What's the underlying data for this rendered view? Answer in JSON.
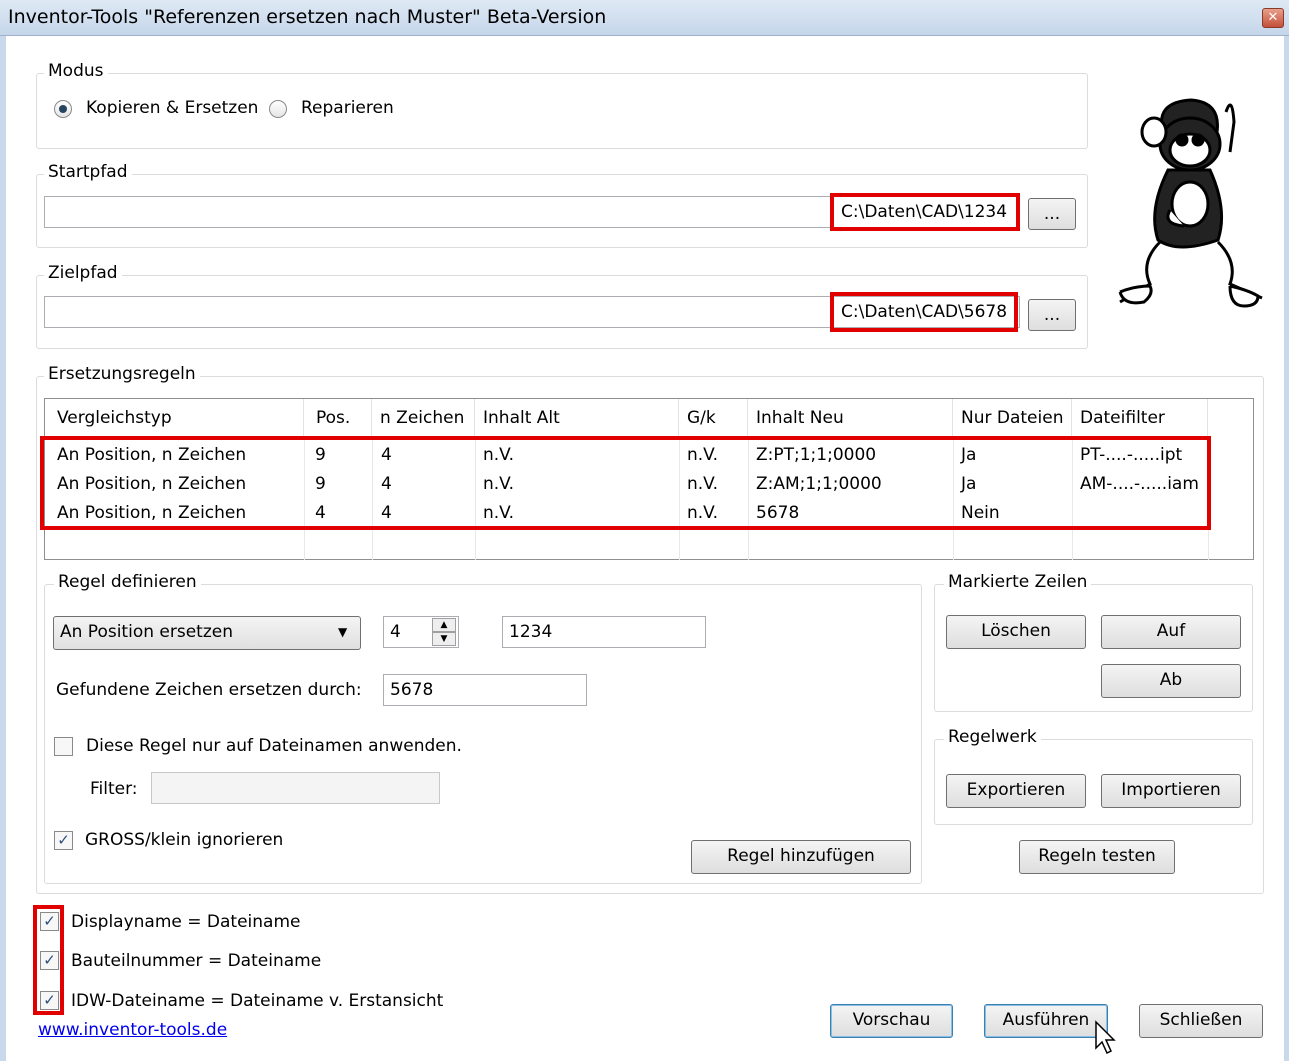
{
  "window": {
    "title": "Inventor-Tools \"Referenzen ersetzen nach Muster\" Beta-Version",
    "close_glyph": "✕"
  },
  "modus": {
    "legend": "Modus",
    "options": [
      {
        "label": "Kopieren & Ersetzen",
        "checked": true
      },
      {
        "label": "Reparieren",
        "checked": false
      }
    ]
  },
  "startpfad": {
    "legend": "Startpfad",
    "value": "C:\\Daten\\CAD\\1234",
    "browse_label": "..."
  },
  "zielpfad": {
    "legend": "Zielpfad",
    "value": "C:\\Daten\\CAD\\5678",
    "browse_label": "..."
  },
  "ersetzungsregeln": {
    "legend": "Ersetzungsregeln",
    "columns": [
      "Vergleichstyp",
      "Pos.",
      "n Zeichen",
      "Inhalt Alt",
      "G/k",
      "Inhalt Neu",
      "Nur Dateien",
      "Dateifilter"
    ],
    "rows": [
      [
        "An Position, n Zeichen",
        "9",
        "4",
        "n.V.",
        "n.V.",
        "Z:PT;1;1;0000",
        "Ja",
        "PT-....-.....ipt"
      ],
      [
        "An Position, n Zeichen",
        "9",
        "4",
        "n.V.",
        "n.V.",
        "Z:AM;1;1;0000",
        "Ja",
        "AM-....-.....iam"
      ],
      [
        "An Position, n Zeichen",
        "4",
        "4",
        "n.V.",
        "n.V.",
        "5678",
        "Nein",
        ""
      ]
    ]
  },
  "regel_definieren": {
    "legend": "Regel definieren",
    "type_select": "An Position ersetzen",
    "position_value": "4",
    "search_value": "1234",
    "replace_label": "Gefundene Zeichen ersetzen durch:",
    "replace_value": "5678",
    "only_filenames_label": "Diese Regel nur auf Dateinamen anwenden.",
    "only_filenames_checked": false,
    "filter_label": "Filter:",
    "filter_value": "",
    "ignore_case_label": "GROSS/klein ignorieren",
    "ignore_case_checked": true,
    "add_rule_label": "Regel hinzufügen"
  },
  "markierte_zeilen": {
    "legend": "Markierte Zeilen",
    "delete_label": "Löschen",
    "up_label": "Auf",
    "down_label": "Ab"
  },
  "regelwerk": {
    "legend": "Regelwerk",
    "export_label": "Exportieren",
    "import_label": "Importieren"
  },
  "test_rules_label": "Regeln testen",
  "options": [
    {
      "label": "Displayname = Dateiname",
      "checked": true
    },
    {
      "label": "Bauteilnummer = Dateiname",
      "checked": true
    },
    {
      "label": "IDW-Dateiname = Dateiname v. Erstansicht",
      "checked": true
    }
  ],
  "website_link": "www.inventor-tools.de",
  "footer": {
    "preview_label": "Vorschau",
    "run_label": "Ausführen",
    "close_label": "Schließen"
  },
  "glyphs": {
    "check": "✓",
    "dropdown_arrow": "▼",
    "spin_up": "▲",
    "spin_down": "▼"
  },
  "colors": {
    "highlight_red": "#e00000",
    "link_blue": "#0000ee",
    "focus_blue": "#3c7fb1"
  }
}
